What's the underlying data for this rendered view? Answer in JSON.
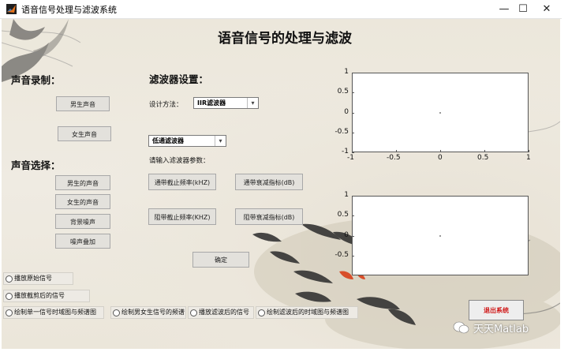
{
  "window": {
    "title": "语音信号处理与滤波系统",
    "minimize_glyph": "—",
    "maximize_glyph": "☐",
    "close_glyph": "✕"
  },
  "main_title": "语音信号的处理与滤波",
  "record_section": {
    "heading": "声音录制：",
    "male_button": "男生声音",
    "female_button": "女生声音"
  },
  "select_section": {
    "heading": "声音选择：",
    "buttons": [
      "男生的声音",
      "女生的声音",
      "背景噪声",
      "噪声叠加"
    ]
  },
  "filter_settings": {
    "heading": "滤波器设置：",
    "design_method_label": "设计方法：",
    "design_method_value": "IIR滤波器",
    "filter_type_value": "低通滤波器",
    "params_label": "请输入滤波器参数：",
    "passband_freq_button": "通带截止频率(kHZ)",
    "passband_atten_button": "通带衰减指标(dB)",
    "stopband_freq_button": "阻带截止频率(KHZ)",
    "stopband_atten_button": "阻带衰减指标(dB)",
    "confirm_button": "确定"
  },
  "radio_options": [
    "播放原始信号",
    "播放截剪后的信号",
    "绘制单一信号时域图与频谱图",
    "绘制男女生信号的频谱",
    "播放滤波后的信号",
    "绘制滤波后的时域图与频谱图"
  ],
  "exit_button": "退出系统",
  "watermark": "天天Matlab",
  "chart_data": [
    {
      "type": "scatter",
      "title": "",
      "xlabel": "",
      "ylabel": "",
      "xlim": [
        -1,
        1
      ],
      "ylim": [
        -1,
        1
      ],
      "x_ticks": [
        "-1",
        "-0.5",
        "0",
        "0.5",
        "1"
      ],
      "y_ticks": [
        "1",
        "0.5",
        "0",
        "-0.5",
        "-1"
      ],
      "series": [
        {
          "x": [
            0
          ],
          "y": [
            0
          ]
        }
      ]
    },
    {
      "type": "scatter",
      "title": "",
      "xlabel": "",
      "ylabel": "",
      "xlim": [
        -1,
        1
      ],
      "ylim": [
        -1,
        1
      ],
      "y_ticks": [
        "1",
        "0.5",
        "0",
        "-0.5"
      ],
      "series": [
        {
          "x": [
            0
          ],
          "y": [
            0
          ]
        }
      ]
    }
  ]
}
